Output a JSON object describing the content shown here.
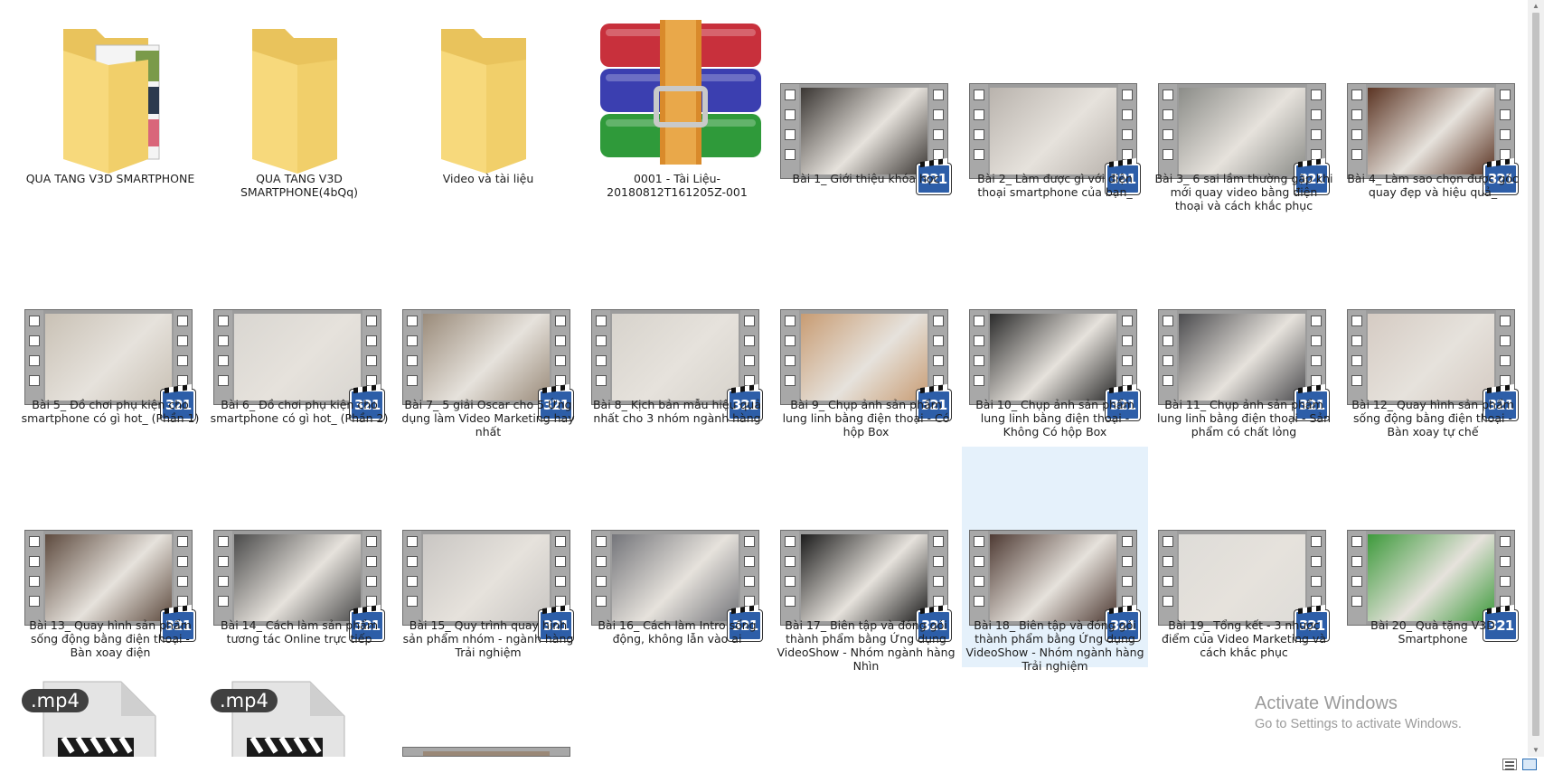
{
  "items": [
    {
      "label": "QUA TANG V3D SMARTPHONE",
      "kind": "folder",
      "icon": "folder-with-documents-icon"
    },
    {
      "label": "QUA TANG V3D SMARTPHONE(4bQq)",
      "kind": "folder",
      "icon": "folder-icon"
    },
    {
      "label": "Video và tài liệu",
      "kind": "folder",
      "icon": "folder-icon"
    },
    {
      "label": "0001 - Tài Liệu-20180812T161205Z-001",
      "kind": "archive",
      "icon": "winrar-archive-icon"
    },
    {
      "label": "Bài 1_ Giới thiệu khóa học",
      "kind": "video",
      "tone": "#3a3633"
    },
    {
      "label": "Bài 2_ Làm được gì với điện thoại smartphone của bạn_",
      "kind": "video",
      "tone": "#b9b3ad"
    },
    {
      "label": "Bài 3_ 6 sai lầm thường gặp khi mới quay video bằng điện thoại và cách khắc phục",
      "kind": "video",
      "tone": "#8b8c88"
    },
    {
      "label": "Bài 4_ Làm sao chọn được góc quay đẹp và hiệu quả_",
      "kind": "video",
      "tone": "#5b3423"
    },
    {
      "label": "Bài 5_ Đồ chơi phụ kiện cho smartphone có gì hot_ (Phần 1)",
      "kind": "video",
      "tone": "#c9c1b5"
    },
    {
      "label": "Bài 6_ Đồ chơi phụ kiện cho smartphone có gì hot_ (Phần 2)",
      "kind": "video",
      "tone": "#d9d6d1"
    },
    {
      "label": "Bài 7_ 5 giải Oscar cho 5 Ứng dụng làm Video Marketing hay nhất",
      "kind": "video",
      "tone": "#9a8b7a"
    },
    {
      "label": "Bài 8_ Kịch bản mẫu hiệu quả nhất cho 3 nhóm ngành hàng",
      "kind": "video",
      "tone": "#d7d3cc"
    },
    {
      "label": "Bài 9_ Chụp ảnh sản phẩm lung linh bằng điện thoại - Có hộp Box",
      "kind": "video",
      "tone": "#c89c73"
    },
    {
      "label": "Bài 10_ Chụp ảnh sản phẩm lung linh bằng điện thoại - Không Có hộp Box",
      "kind": "video",
      "tone": "#2b2b2b"
    },
    {
      "label": "Bài 11_ Chụp ảnh sản phẩm lung linh bằng điện thoại - Sản phẩm có chất lỏng",
      "kind": "video",
      "tone": "#4b4b4e"
    },
    {
      "label": "Bài 12_ Quay hình sản phẩm sống động bằng điện thoại - Bàn xoay tự chế",
      "kind": "video",
      "tone": "#d5cbc3"
    },
    {
      "label": "Bài 13_ Quay hình sản phẩm sống động bằng điện thoại - Bàn xoay điện",
      "kind": "video",
      "tone": "#5d4a3e"
    },
    {
      "label": "Bài 14_ Cách làm sản phẩm tương tác Online trực tiếp",
      "kind": "video",
      "tone": "#4a4a4a"
    },
    {
      "label": "Bài 15_ Quy trình quay hình sản phẩm nhóm - ngành hàng Trải nghiệm",
      "kind": "video",
      "tone": "#c9c6c3"
    },
    {
      "label": "Bài 16_ Cách làm Intro sống động, không lẫn vào ai",
      "kind": "video",
      "tone": "#74757a"
    },
    {
      "label": "Bài 17_ Biên tập và đóng gói thành phẩm bằng Ứng dụng VideoShow - Nhóm ngành hàng Nhìn",
      "kind": "video",
      "tone": "#1c1c1c"
    },
    {
      "label": "Bài 18_ Biên tập và đóng gói thành phẩm bằng Ứng dụng VideoShow - Nhóm ngành hàng Trải nghiệm",
      "kind": "video",
      "tone": "#4e3a33",
      "selected": true
    },
    {
      "label": "Bài 19_ Tổng kết - 3 nhược điểm của Video Marketing và cách khắc phục",
      "kind": "video",
      "tone": "#dedcd8"
    },
    {
      "label": "Bài 20_ Quà tặng V3D Smartphone",
      "kind": "video",
      "tone": "#3d9a3b"
    }
  ],
  "mp4_icons": [
    {
      "ext": ".mp4",
      "icon": "mp4-file-icon"
    },
    {
      "ext": ".mp4",
      "icon": "mp4-file-icon"
    }
  ],
  "badge_text": "321",
  "watermark": {
    "line1": "Activate Windows",
    "line2": "Go to Settings to activate Windows."
  }
}
